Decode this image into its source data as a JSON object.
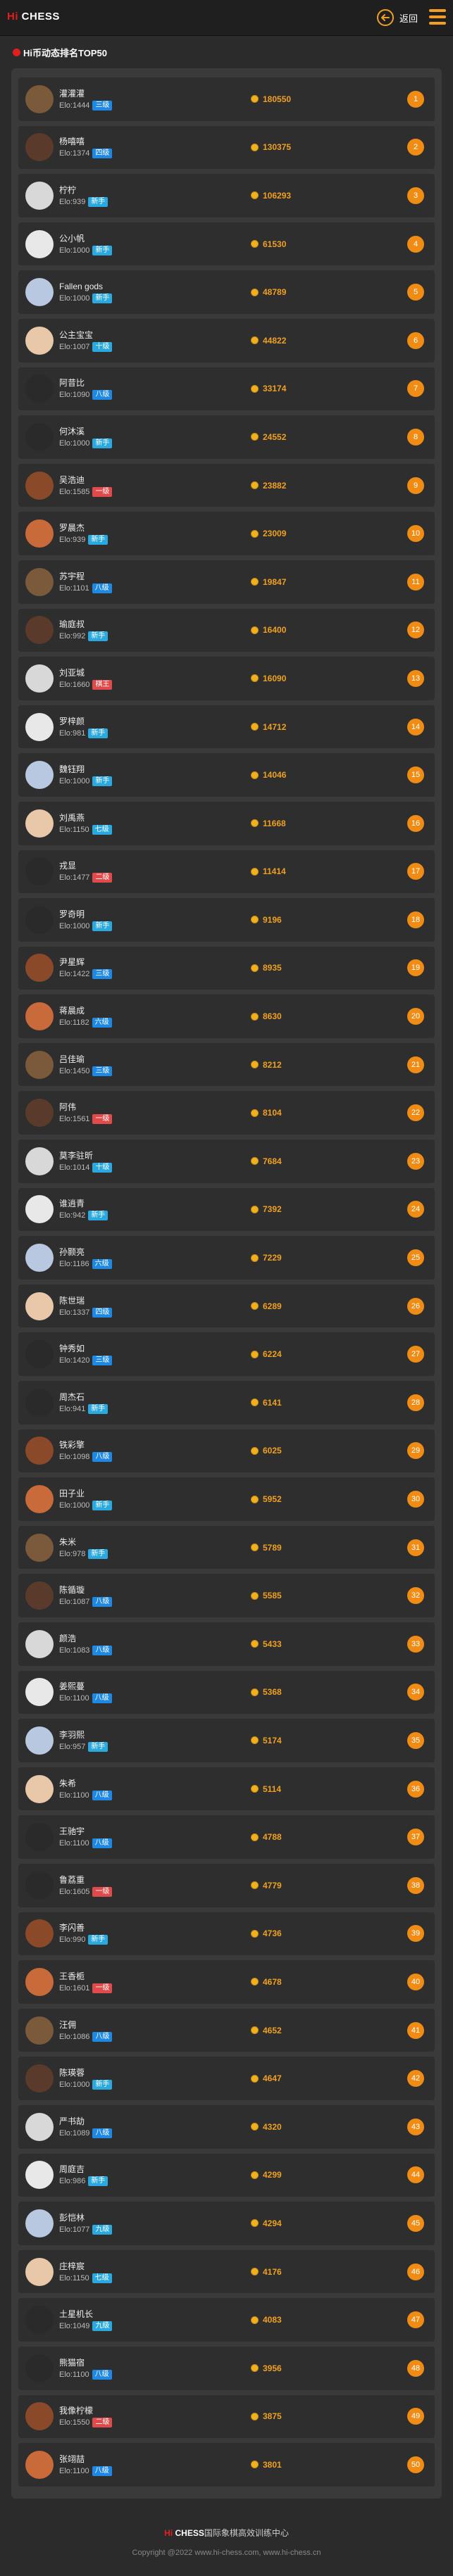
{
  "header": {
    "logo_hi": "Hi",
    "logo_chess": "CHESS",
    "back_label": "返回"
  },
  "section": {
    "title": "Hi币动态排名TOP50"
  },
  "colors": {
    "accent": "#f0a020",
    "brand_red": "#e02020",
    "rank_bg": "#f08c14"
  },
  "level_colors": {
    "三级": "#1e88e5",
    "四级": "#1e88e5",
    "新手": "#29a9e0",
    "十级": "#29a9e0",
    "八级": "#1e88e5",
    "一级": "#e04a4a",
    "二级": "#e04a4a",
    "六级": "#1e88e5",
    "七级": "#29a9e0",
    "棋王": "#e04a4a",
    "九级": "#29a9e0",
    "五级": "#1e88e5"
  },
  "players": [
    {
      "name": "灌灌灌",
      "elo": "Elo:1444",
      "level": "三级",
      "coins": "180550",
      "rank": "1"
    },
    {
      "name": "杨嘻嘻",
      "elo": "Elo:1374",
      "level": "四级",
      "coins": "130375",
      "rank": "2"
    },
    {
      "name": "柠柠",
      "elo": "Elo:939",
      "level": "新手",
      "coins": "106293",
      "rank": "3"
    },
    {
      "name": "公小帆",
      "elo": "Elo:1000",
      "level": "新手",
      "coins": "61530",
      "rank": "4"
    },
    {
      "name": "Fallen gods",
      "elo": "Elo:1000",
      "level": "新手",
      "coins": "48789",
      "rank": "5"
    },
    {
      "name": "公主宝宝",
      "elo": "Elo:1007",
      "level": "十级",
      "coins": "44822",
      "rank": "6"
    },
    {
      "name": "阿昔比",
      "elo": "Elo:1090",
      "level": "八级",
      "coins": "33174",
      "rank": "7"
    },
    {
      "name": "何沐溪",
      "elo": "Elo:1000",
      "level": "新手",
      "coins": "24552",
      "rank": "8"
    },
    {
      "name": "吴浩迪",
      "elo": "Elo:1585",
      "level": "一级",
      "coins": "23882",
      "rank": "9"
    },
    {
      "name": "罗晨杰",
      "elo": "Elo:939",
      "level": "新手",
      "coins": "23009",
      "rank": "10"
    },
    {
      "name": "苏宇程",
      "elo": "Elo:1101",
      "level": "八级",
      "coins": "19847",
      "rank": "11"
    },
    {
      "name": "瑜庭叔",
      "elo": "Elo:992",
      "level": "新手",
      "coins": "16400",
      "rank": "12"
    },
    {
      "name": "刘亚城",
      "elo": "Elo:1660",
      "level": "棋王",
      "coins": "16090",
      "rank": "13"
    },
    {
      "name": "罗梓颜",
      "elo": "Elo:981",
      "level": "新手",
      "coins": "14712",
      "rank": "14"
    },
    {
      "name": "魏钰翔",
      "elo": "Elo:1000",
      "level": "新手",
      "coins": "14046",
      "rank": "15"
    },
    {
      "name": "刘禹燕",
      "elo": "Elo:1150",
      "level": "七级",
      "coins": "11668",
      "rank": "16"
    },
    {
      "name": "戎显",
      "elo": "Elo:1477",
      "level": "二级",
      "coins": "11414",
      "rank": "17"
    },
    {
      "name": "罗奇明",
      "elo": "Elo:1000",
      "level": "新手",
      "coins": "9196",
      "rank": "18"
    },
    {
      "name": "尹星辉",
      "elo": "Elo:1422",
      "level": "三级",
      "coins": "8935",
      "rank": "19"
    },
    {
      "name": "蒋晨成",
      "elo": "Elo:1182",
      "level": "六级",
      "coins": "8630",
      "rank": "20"
    },
    {
      "name": "吕佳瑜",
      "elo": "Elo:1450",
      "level": "三级",
      "coins": "8212",
      "rank": "21"
    },
    {
      "name": "阿伟",
      "elo": "Elo:1561",
      "level": "一级",
      "coins": "8104",
      "rank": "22"
    },
    {
      "name": "莫李驻昕",
      "elo": "Elo:1014",
      "level": "十级",
      "coins": "7684",
      "rank": "23"
    },
    {
      "name": "谁逍青",
      "elo": "Elo:942",
      "level": "新手",
      "coins": "7392",
      "rank": "24"
    },
    {
      "name": "孙颢亮",
      "elo": "Elo:1186",
      "level": "六级",
      "coins": "7229",
      "rank": "25"
    },
    {
      "name": "陈世瑞",
      "elo": "Elo:1337",
      "level": "四级",
      "coins": "6289",
      "rank": "26"
    },
    {
      "name": "钟秀如",
      "elo": "Elo:1420",
      "level": "三级",
      "coins": "6224",
      "rank": "27"
    },
    {
      "name": "周杰石",
      "elo": "Elo:941",
      "level": "新手",
      "coins": "6141",
      "rank": "28"
    },
    {
      "name": "铁彩擎",
      "elo": "Elo:1098",
      "level": "八级",
      "coins": "6025",
      "rank": "29"
    },
    {
      "name": "田子业",
      "elo": "Elo:1000",
      "level": "新手",
      "coins": "5952",
      "rank": "30"
    },
    {
      "name": "朱米",
      "elo": "Elo:978",
      "level": "新手",
      "coins": "5789",
      "rank": "31"
    },
    {
      "name": "陈循璇",
      "elo": "Elo:1087",
      "level": "八级",
      "coins": "5585",
      "rank": "32"
    },
    {
      "name": "颜浩",
      "elo": "Elo:1083",
      "level": "八级",
      "coins": "5433",
      "rank": "33"
    },
    {
      "name": "姜熙蔓",
      "elo": "Elo:1100",
      "level": "八级",
      "coins": "5368",
      "rank": "34"
    },
    {
      "name": "李羽熙",
      "elo": "Elo:957",
      "level": "新手",
      "coins": "5174",
      "rank": "35"
    },
    {
      "name": "朱希",
      "elo": "Elo:1100",
      "level": "八级",
      "coins": "5114",
      "rank": "36"
    },
    {
      "name": "王驰宇",
      "elo": "Elo:1100",
      "level": "八级",
      "coins": "4788",
      "rank": "37"
    },
    {
      "name": "鲁荔重",
      "elo": "Elo:1605",
      "level": "一级",
      "coins": "4779",
      "rank": "38"
    },
    {
      "name": "李闪善",
      "elo": "Elo:990",
      "level": "新手",
      "coins": "4736",
      "rank": "39"
    },
    {
      "name": "王香栀",
      "elo": "Elo:1601",
      "level": "一级",
      "coins": "4678",
      "rank": "40"
    },
    {
      "name": "汪佣",
      "elo": "Elo:1086",
      "level": "八级",
      "coins": "4652",
      "rank": "41"
    },
    {
      "name": "陈瑛蓉",
      "elo": "Elo:1000",
      "level": "新手",
      "coins": "4647",
      "rank": "42"
    },
    {
      "name": "严书劼",
      "elo": "Elo:1089",
      "level": "八级",
      "coins": "4320",
      "rank": "43"
    },
    {
      "name": "周庭吉",
      "elo": "Elo:986",
      "level": "新手",
      "coins": "4299",
      "rank": "44"
    },
    {
      "name": "彭恺林",
      "elo": "Elo:1077",
      "level": "九级",
      "coins": "4294",
      "rank": "45"
    },
    {
      "name": "庄梓宸",
      "elo": "Elo:1150",
      "level": "七级",
      "coins": "4176",
      "rank": "46"
    },
    {
      "name": "土星机长",
      "elo": "Elo:1049",
      "level": "九级",
      "coins": "4083",
      "rank": "47"
    },
    {
      "name": "熊猫宿",
      "elo": "Elo:1100",
      "level": "八级",
      "coins": "3956",
      "rank": "48"
    },
    {
      "name": "我像柠檬",
      "elo": "Elo:1550",
      "level": "二级",
      "coins": "3875",
      "rank": "49"
    },
    {
      "name": "张翊喆",
      "elo": "Elo:1100",
      "level": "八级",
      "coins": "3801",
      "rank": "50"
    }
  ],
  "footer": {
    "title_hi": "Hi",
    "title_chess": "CHESS",
    "title_rest": "国际象棋高效训练中心",
    "copyright": "Copyright @2022 www.hi-chess.com, www.hi-chess.cn"
  }
}
